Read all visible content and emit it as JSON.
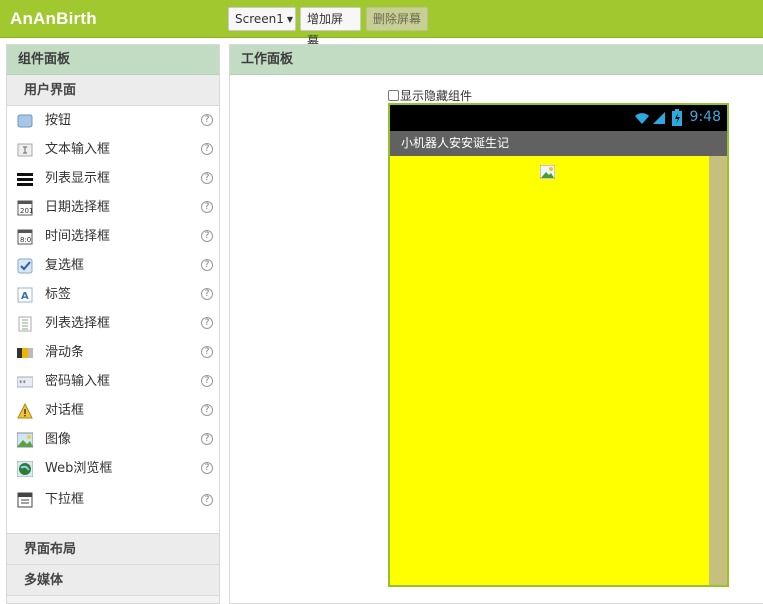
{
  "app": {
    "title": "AnAnBirth"
  },
  "toolbar": {
    "screen_select": "Screen1",
    "add_screen": "增加屏幕",
    "remove_screen": "删除屏幕"
  },
  "palette": {
    "header": "组件面板",
    "categories": [
      "用户界面",
      "界面布局",
      "多媒体"
    ],
    "items": [
      {
        "label": "按钮",
        "icon": "button-icon"
      },
      {
        "label": "文本输入框",
        "icon": "textbox-icon"
      },
      {
        "label": "列表显示框",
        "icon": "listview-icon"
      },
      {
        "label": "日期选择框",
        "icon": "datepicker-icon"
      },
      {
        "label": "时间选择框",
        "icon": "timepicker-icon"
      },
      {
        "label": "复选框",
        "icon": "checkbox-icon"
      },
      {
        "label": "标签",
        "icon": "label-icon"
      },
      {
        "label": "列表选择框",
        "icon": "listpicker-icon"
      },
      {
        "label": "滑动条",
        "icon": "slider-icon"
      },
      {
        "label": "密码输入框",
        "icon": "password-icon"
      },
      {
        "label": "对话框",
        "icon": "notifier-icon"
      },
      {
        "label": "图像",
        "icon": "image-icon"
      },
      {
        "label": "Web浏览框",
        "icon": "webviewer-icon"
      },
      {
        "label": "下拉框",
        "icon": "spinner-icon"
      }
    ],
    "help_glyph": "?"
  },
  "viewer": {
    "header": "工作面板",
    "show_hidden_label": "显示隐藏组件",
    "phone": {
      "time": "9:48",
      "screen_title": "小机器人安安诞生记",
      "background": "#ffff00"
    }
  },
  "colors": {
    "accent": "#a1c92f",
    "panel_header": "#c2dcc3"
  }
}
